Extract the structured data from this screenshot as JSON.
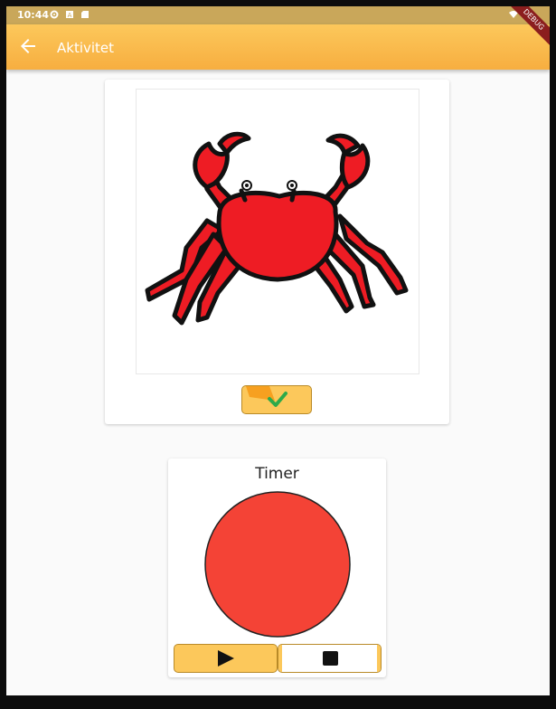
{
  "status_bar": {
    "time": "10:44"
  },
  "app_bar": {
    "title": "Aktivitet",
    "debug_label": "DEBUG"
  },
  "activity": {
    "image_icon": "crab-icon",
    "done_icon": "checkmark-icon"
  },
  "timer": {
    "title": "Timer",
    "remaining_fraction": 1.0,
    "color": "#f44336",
    "play_icon": "play-icon",
    "stop_icon": "stop-icon"
  },
  "colors": {
    "accent": "#fcc85b",
    "accent_dark": "#f7ae40",
    "check": "#2eaa4a",
    "crab": "#ee1c24"
  }
}
